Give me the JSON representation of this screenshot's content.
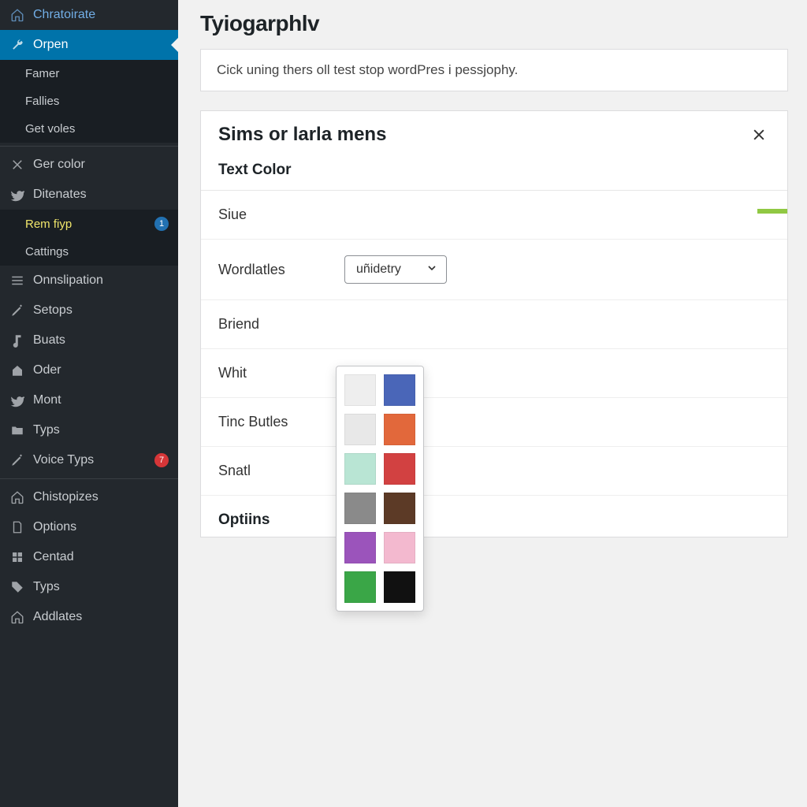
{
  "sidebar": {
    "top": [
      {
        "icon": "house",
        "label": "Chratoirate"
      },
      {
        "icon": "wrench",
        "label": "Orpen",
        "active": true
      }
    ],
    "sub1": [
      {
        "label": "Famer"
      },
      {
        "label": "Fallies"
      },
      {
        "label": "Get voles"
      }
    ],
    "group2": [
      {
        "icon": "close",
        "label": "Ger color"
      },
      {
        "icon": "bird",
        "label": "Ditenates"
      }
    ],
    "sub2": [
      {
        "label": "Rem fiyp",
        "sub_active": true,
        "badge": "1"
      },
      {
        "label": "Cattings"
      }
    ],
    "group3": [
      {
        "icon": "menu",
        "label": "Onnslipation"
      },
      {
        "icon": "pencil",
        "label": "Setops"
      },
      {
        "icon": "note",
        "label": "Buats"
      },
      {
        "icon": "home",
        "label": "Oder"
      },
      {
        "icon": "bird",
        "label": "Mont"
      },
      {
        "icon": "folder",
        "label": "Typs"
      },
      {
        "icon": "pencil",
        "label": "Voice Typs",
        "badge_red": "7"
      }
    ],
    "group4": [
      {
        "icon": "house",
        "label": "Chistopizes"
      },
      {
        "icon": "doc",
        "label": "Options"
      },
      {
        "icon": "grid",
        "label": "Centad"
      },
      {
        "icon": "tag",
        "label": "Typs"
      },
      {
        "icon": "house",
        "label": "Addlates"
      }
    ]
  },
  "main": {
    "page_title": "Tyiogarphlv",
    "info_text": "Cick uning thers oll test stop wordPres i pessjophy.",
    "card_title": "Sims or larla mens",
    "section_heading": "Text Color",
    "rows": [
      {
        "label": "Siue"
      },
      {
        "label": "Wordlatles",
        "select_value": "uñidetry"
      },
      {
        "label": "Briend"
      },
      {
        "label": "Whit"
      },
      {
        "label": "Tinc Butles"
      },
      {
        "label": "Snatl"
      }
    ],
    "options_heading": "Optiins"
  },
  "colors": {
    "swatches": [
      "#eeeeee",
      "#4a66b8",
      "#e8e8e8",
      "#e2683b",
      "#b9e5d4",
      "#d24141",
      "#8a8a8a",
      "#5c3a26",
      "#9b54bb",
      "#f3b9cf",
      "#3aa647",
      "#111111"
    ]
  }
}
